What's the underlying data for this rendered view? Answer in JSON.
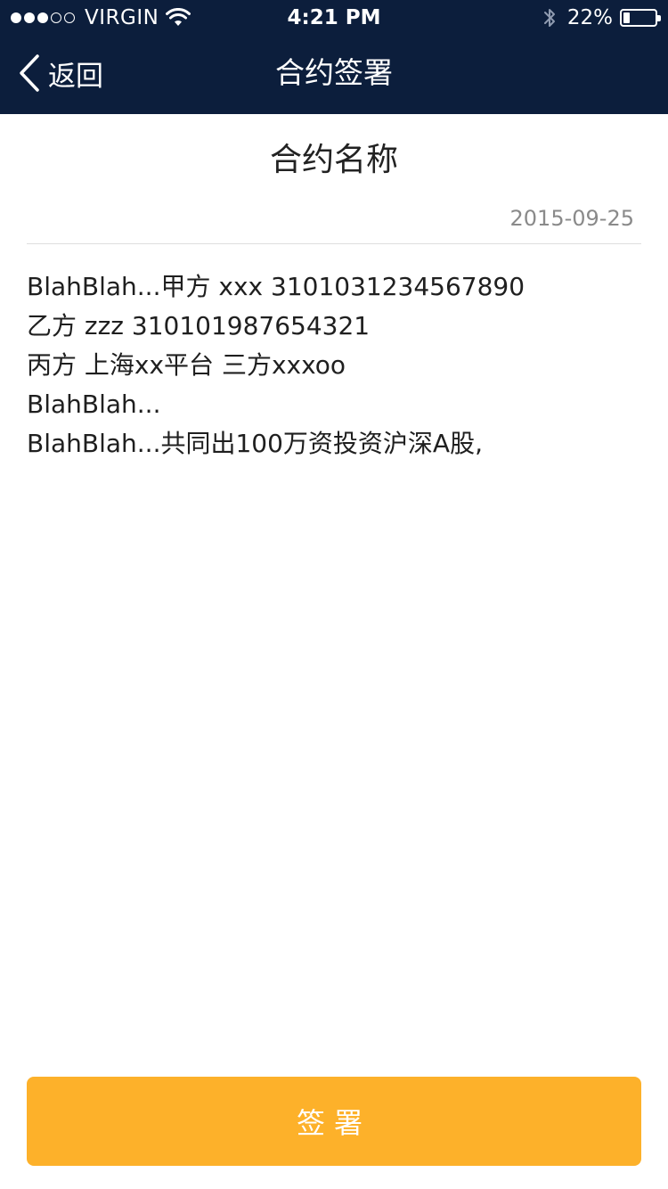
{
  "status_bar": {
    "carrier": "VIRGIN",
    "signal_bars_filled": 3,
    "signal_bars_total": 5,
    "time": "4:21 PM",
    "battery_text": "22%",
    "battery_level": 0.22,
    "icons": [
      "wifi-icon",
      "bluetooth-icon",
      "battery-icon"
    ]
  },
  "nav": {
    "back_label": "返回",
    "title": "合约签署",
    "back_icon": "chevron-left-icon"
  },
  "document": {
    "title": "合约名称",
    "date": "2015-09-25",
    "lines": [
      "BlahBlah...甲方 xxx 3101031234567890",
      "乙方 zzz 310101987654321",
      "丙方 上海xx平台 三方xxxoo",
      "BlahBlah...",
      "BlahBlah...共同出100万资投资沪深A股,"
    ]
  },
  "actions": {
    "sign_label": "签署"
  },
  "colors": {
    "nav_background": "#0c1e3c",
    "accent": "#fdb12a",
    "text": "#1f1f1f",
    "muted": "#8a8a8a"
  }
}
